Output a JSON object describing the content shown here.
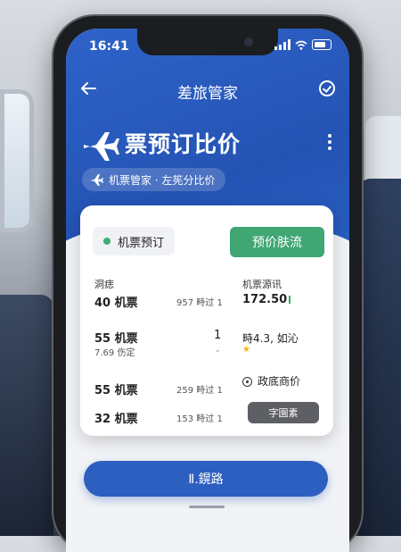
{
  "status_bar": {
    "time": "16:41"
  },
  "nav": {
    "back_icon": "arrow-left-icon",
    "title": "差旅管家",
    "action_icon": "check-circle-icon"
  },
  "hero": {
    "title": "票预订比价",
    "subtitle": "机票管家 · 左筅分比价"
  },
  "card": {
    "tab_label": "机票预订",
    "primary_button": "预价肤流",
    "left_header": "洞痣",
    "right_header": "机票源讯",
    "rows": [
      {
        "name": "40 机票",
        "meta": "957 畤过 1"
      },
      {
        "name": "55 机票",
        "sub": "7.69 伤定",
        "meta": "1"
      },
      {
        "name": "55 机票",
        "meta": "259 畤过 1"
      },
      {
        "name": "32 机票",
        "meta": "153 畤过 1"
      }
    ],
    "right_price": "172.50",
    "right_rating": "畤4.3, 如沁",
    "right_compare": "政底商价",
    "right_button": "字園素"
  },
  "bottom_button": "Ⅱ.鎤路",
  "colors": {
    "primary": "#2d5fc0",
    "accent": "#3fa674",
    "dark_button": "#5d5f64"
  }
}
